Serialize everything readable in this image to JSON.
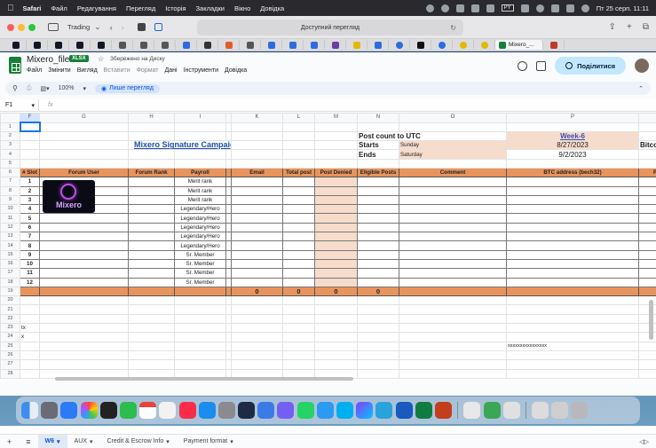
{
  "menubar": {
    "app_name": "Safari",
    "items": [
      "Файл",
      "Редагування",
      "Перегляд",
      "Історія",
      "Закладки",
      "Вікно",
      "Довідка"
    ],
    "badge": "PY",
    "clock": "Пт 25 серп.  11:11"
  },
  "safari": {
    "tabgroup": "Trading",
    "address": "Доступний перегляд",
    "active_tab": "Mixero_..."
  },
  "doc": {
    "title": "Mixero_file",
    "format": "XLSX",
    "saved": "Збережено на Диску",
    "menus": [
      "Файл",
      "Змінити",
      "Вигляд",
      "Вставити",
      "Формат",
      "Дані",
      "Інструменти",
      "Довідка"
    ],
    "menus_disabled": [
      false,
      false,
      false,
      true,
      true,
      false,
      false,
      false
    ],
    "share": "Поділитися",
    "zoom": "100%",
    "view_mode": "Лише перегляд",
    "namebox": "F1",
    "fx": "fx"
  },
  "grid": {
    "columns": [
      "",
      "F",
      "G",
      "H",
      "I",
      "",
      "K",
      "L",
      "M",
      "N",
      "O",
      "P",
      "Re"
    ],
    "logo_text": "Mixero",
    "title": "Mixero Signature Campaign",
    "post_count": "Post count to UTC",
    "week": "Week-6",
    "starts_label": "Starts",
    "starts_day": "Sunday",
    "starts_date": "8/27/2023",
    "ends_label": "Ends",
    "ends_day": "Saturday",
    "ends_date": "9/2/2023",
    "btc_rate": "Bitcoin Rate When Week Ended:",
    "headers": [
      "# Slot",
      "Forum User",
      "Forum Rank",
      "Payroll",
      "Email",
      "Total post",
      "Post Denied",
      "Eligible Posts",
      "Comment",
      "BTC address (bech32)",
      "Re"
    ],
    "slots": [
      {
        "n": "1",
        "payroll": "Merit rank"
      },
      {
        "n": "2",
        "payroll": "Merit rank"
      },
      {
        "n": "3",
        "payroll": "Merit rank"
      },
      {
        "n": "4",
        "payroll": "Legendary/Hero"
      },
      {
        "n": "5",
        "payroll": "Legendary/Hero"
      },
      {
        "n": "6",
        "payroll": "Legendary/Hero"
      },
      {
        "n": "7",
        "payroll": "Legendary/Hero"
      },
      {
        "n": "8",
        "payroll": "Legendary/Hero"
      },
      {
        "n": "9",
        "payroll": "Sr. Member"
      },
      {
        "n": "10",
        "payroll": "Sr. Member"
      },
      {
        "n": "11",
        "payroll": "Sr. Member"
      },
      {
        "n": "12",
        "payroll": "Sr. Member"
      }
    ],
    "totals": [
      "0",
      "0",
      "0",
      "0"
    ],
    "tx": "tx",
    "x_row24": "x",
    "xs": "xxxxxxxxxxxxxxxx"
  },
  "sheets": [
    "W6",
    "AUX",
    "Credit & Escrow Info",
    "Payment format"
  ]
}
